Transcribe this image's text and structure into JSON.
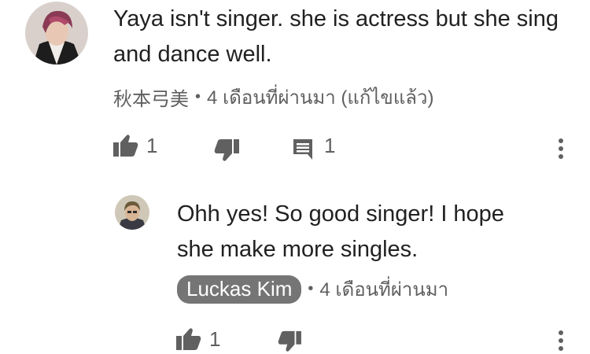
{
  "comment": {
    "text": "Yaya isn't singer. she is actress but she sing and dance well.",
    "author": "秋本弓美",
    "separator": "•",
    "time": "4 เดือนที่ผ่านมา (แก้ไขแล้ว)",
    "like_count": "1",
    "reply_count": "1",
    "icons": [
      "thumbs-up-icon",
      "thumbs-down-icon",
      "reply-icon",
      "more-options-icon"
    ]
  },
  "reply": {
    "text": "Ohh yes! So good singer! I hope she make more singles.",
    "author": "Luckas Kim",
    "separator": "•",
    "time": "4 เดือนที่ผ่านมา",
    "like_count": "1",
    "icons": [
      "thumbs-up-icon",
      "thumbs-down-icon",
      "more-options-icon"
    ]
  },
  "colors": {
    "text": "#212121",
    "meta": "#606060",
    "chip": "#757575",
    "icon": "#606060"
  }
}
